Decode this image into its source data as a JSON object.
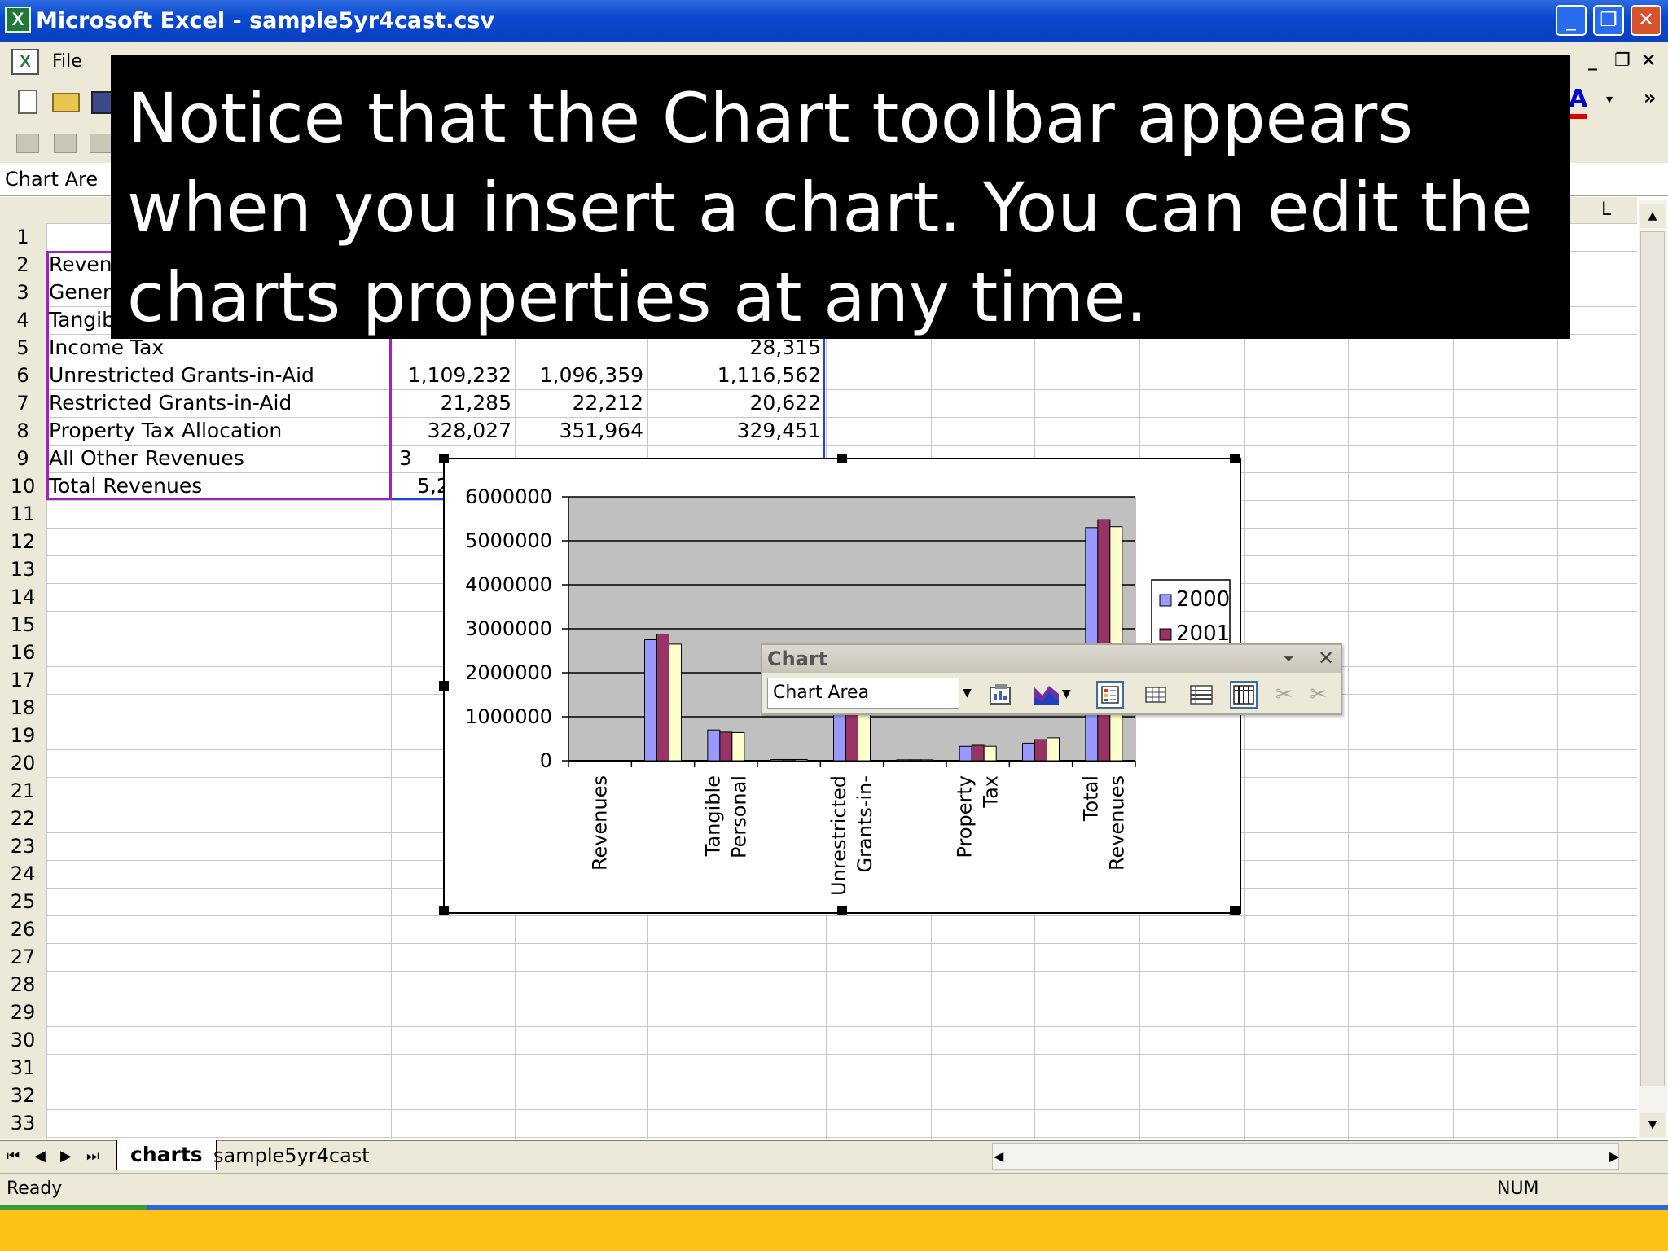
{
  "window": {
    "title": "Microsoft Excel - sample5yr4cast.csv",
    "app_icon": "X",
    "doc_icon": "X"
  },
  "menu": {
    "file": "File"
  },
  "name_box": {
    "value": "Chart Are"
  },
  "columns": {
    "L": "L"
  },
  "rows": [
    "1",
    "2",
    "3",
    "4",
    "5",
    "6",
    "7",
    "8",
    "9",
    "10",
    "11",
    "12",
    "13",
    "14",
    "15",
    "16",
    "17",
    "18",
    "19",
    "20",
    "21",
    "22",
    "23",
    "24",
    "25",
    "26",
    "27",
    "28",
    "29",
    "30",
    "31",
    "32",
    "33"
  ],
  "cells": {
    "r2": "Revenu",
    "r3": "Genera",
    "r4": "Tangib",
    "r5": "Income Tax",
    "r6": "Unrestricted Grants-in-Aid",
    "r7": "Restricted Grants-in-Aid",
    "r8": "Property Tax Allocation",
    "r9": "All Other Revenues",
    "r10": "Total Revenues",
    "r5d": "28,315",
    "r6b": "1,109,232",
    "r6c": "1,096,359",
    "r6d": "1,116,562",
    "r7b": "21,285",
    "r7c": "22,212",
    "r7d": "20,622",
    "r8b": "328,027",
    "r8c": "351,964",
    "r8d": "329,451",
    "r9b": "3",
    "r10b": "5,2"
  },
  "sheet_tabs": {
    "active": "charts",
    "other": "sample5yr4cast"
  },
  "status": {
    "ready": "Ready",
    "num": "NUM"
  },
  "chart_toolbar": {
    "title": "Chart",
    "object_select": "Chart Area",
    "close": "✕",
    "menu_arrow": "⏷"
  },
  "overlay": {
    "text": "Notice that the Chart toolbar appears when you insert a chart.  You can edit the charts properties at any time."
  },
  "colors": {
    "series_2000": "#9999ff",
    "series_2001": "#993366",
    "series_2002": "#ffffcc",
    "plot_bg": "#c0c0c0",
    "overlay_bg": "#000000"
  },
  "chart_data": {
    "type": "bar",
    "categories": [
      "Revenues",
      "General",
      "Tangible Personal",
      "Income Tax",
      "Unrestricted Grants-in-Aid",
      "Restricted Grants-in-Aid",
      "Property Tax",
      "All Other Revenues",
      "Total Revenues"
    ],
    "category_labels": [
      [
        "Revenues"
      ],
      [],
      [
        "Tangible",
        "Personal"
      ],
      [],
      [
        "Unrestricted",
        "Grants-in-"
      ],
      [],
      [
        "Property",
        "Tax"
      ],
      [],
      [
        "Total",
        "Revenues"
      ]
    ],
    "series": [
      {
        "name": "2000",
        "values": [
          0,
          2750000,
          700000,
          28000,
          1109232,
          21285,
          328027,
          400000,
          5300000
        ]
      },
      {
        "name": "2001",
        "values": [
          0,
          2880000,
          650000,
          28000,
          1096359,
          22212,
          351964,
          480000,
          5480000
        ]
      },
      {
        "values": [
          0,
          2650000,
          640000,
          28315,
          1116562,
          20622,
          329451,
          520000,
          5320000
        ]
      }
    ],
    "legend": [
      "2000",
      "2001"
    ],
    "yticks": [
      "6000000",
      "5000000",
      "4000000",
      "3000000",
      "2000000",
      "1000000",
      "0"
    ],
    "ylim": [
      0,
      6000000
    ],
    "grid": true,
    "legend_position": "right"
  }
}
